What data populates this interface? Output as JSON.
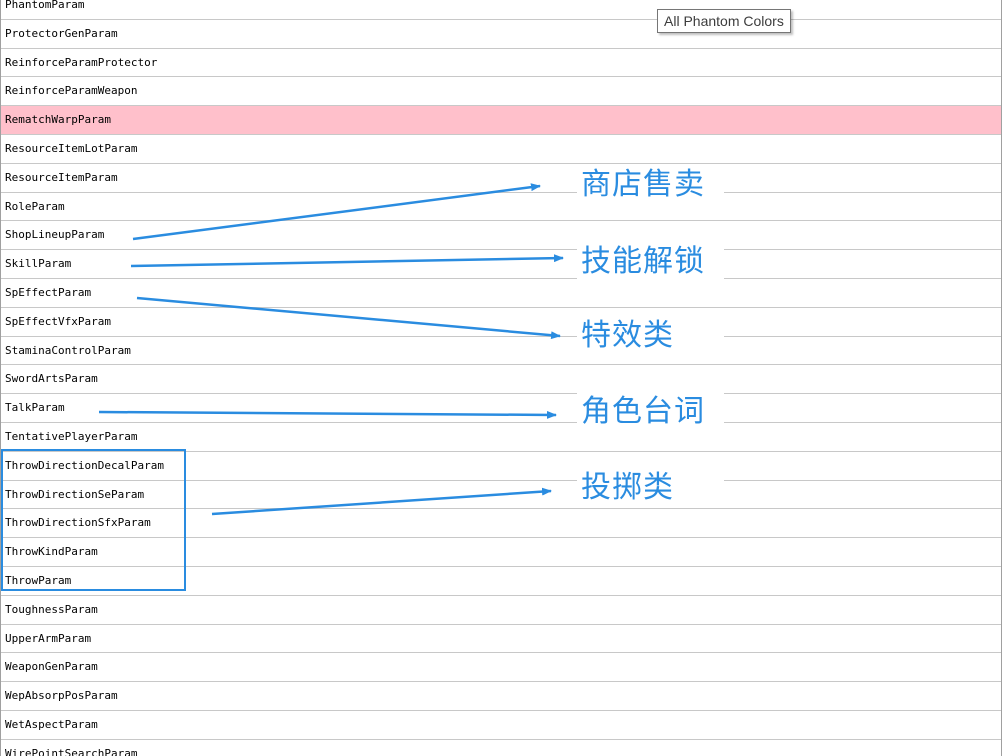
{
  "param_list": {
    "items": [
      "PhantomParam",
      "ProtectorGenParam",
      "ReinforceParamProtector",
      "ReinforceParamWeapon",
      "RematchWarpParam",
      "ResourceItemLotParam",
      "ResourceItemParam",
      "RoleParam",
      "ShopLineupParam",
      "SkillParam",
      "SpEffectParam",
      "SpEffectVfxParam",
      "StaminaControlParam",
      "SwordArtsParam",
      "TalkParam",
      "TentativePlayerParam",
      "ThrowDirectionDecalParam",
      "ThrowDirectionSeParam",
      "ThrowDirectionSfxParam",
      "ThrowKindParam",
      "ThrowParam",
      "ToughnessParam",
      "UpperArmParam",
      "WeaponGenParam",
      "WepAbsorpPosParam",
      "WetAspectParam",
      "WirePointSearchParam"
    ],
    "selected_item": "RematchWarpParam"
  },
  "tooltip": {
    "text": "All Phantom Colors"
  },
  "annotations": [
    {
      "text": "商店售卖",
      "target": "ShopLineupParam"
    },
    {
      "text": "技能解锁",
      "target": "SkillParam"
    },
    {
      "text": "特效类",
      "target": "SpEffectParam"
    },
    {
      "text": "角色台词",
      "target": "TalkParam"
    },
    {
      "text": "投掷类",
      "target": "ThrowDirectionSfxParam"
    }
  ],
  "colors": {
    "selected_row": "#ffc0cb",
    "annotation": "#2a8ce0",
    "row_divider": "#c8c8c8"
  }
}
